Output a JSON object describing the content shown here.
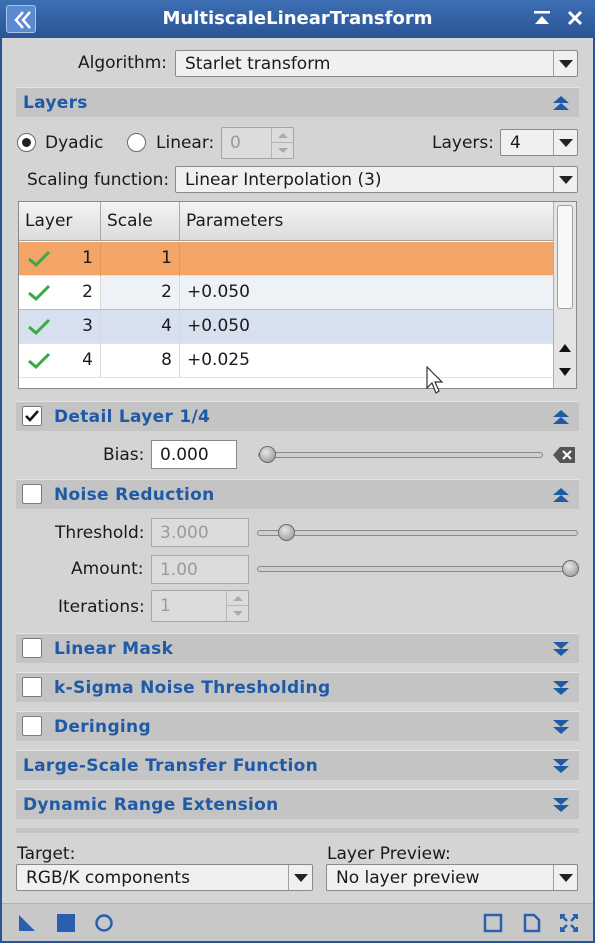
{
  "window": {
    "title": "MultiscaleLinearTransform"
  },
  "algorithm": {
    "label": "Algorithm:",
    "value": "Starlet transform"
  },
  "layers_section": {
    "title": "Layers",
    "dyadic_label": "Dyadic",
    "linear_label": "Linear:",
    "linear_value": "0",
    "layers_label": "Layers:",
    "layers_value": "4",
    "scaling_label": "Scaling function:",
    "scaling_value": "Linear Interpolation (3)",
    "table": {
      "columns": [
        "Layer",
        "Scale",
        "Parameters"
      ],
      "rows": [
        {
          "layer": "1",
          "scale": "1",
          "params": ""
        },
        {
          "layer": "2",
          "scale": "2",
          "params": "+0.050"
        },
        {
          "layer": "3",
          "scale": "4",
          "params": "+0.050"
        },
        {
          "layer": "4",
          "scale": "8",
          "params": "+0.025"
        }
      ]
    }
  },
  "detail_section": {
    "title": "Detail Layer 1/4",
    "checked": true,
    "bias_label": "Bias:",
    "bias_value": "0.000"
  },
  "noise_section": {
    "title": "Noise Reduction",
    "checked": false,
    "threshold_label": "Threshold:",
    "threshold_value": "3.000",
    "amount_label": "Amount:",
    "amount_value": "1.00",
    "iterations_label": "Iterations:",
    "iterations_value": "1"
  },
  "collapsed_sections": {
    "linear_mask": "Linear Mask",
    "ksigma": "k-Sigma Noise Thresholding",
    "deringing": "Deringing",
    "large_scale": "Large-Scale Transfer Function",
    "dynamic_range": "Dynamic Range Extension"
  },
  "footer": {
    "target_label": "Target:",
    "target_value": "RGB/K components",
    "preview_label": "Layer Preview:",
    "preview_value": "No layer preview"
  },
  "colors": {
    "title_bar": "#2a5495",
    "section_title": "#1f5aa6",
    "selected_row": "#f0a664",
    "check": "#3aa845"
  }
}
